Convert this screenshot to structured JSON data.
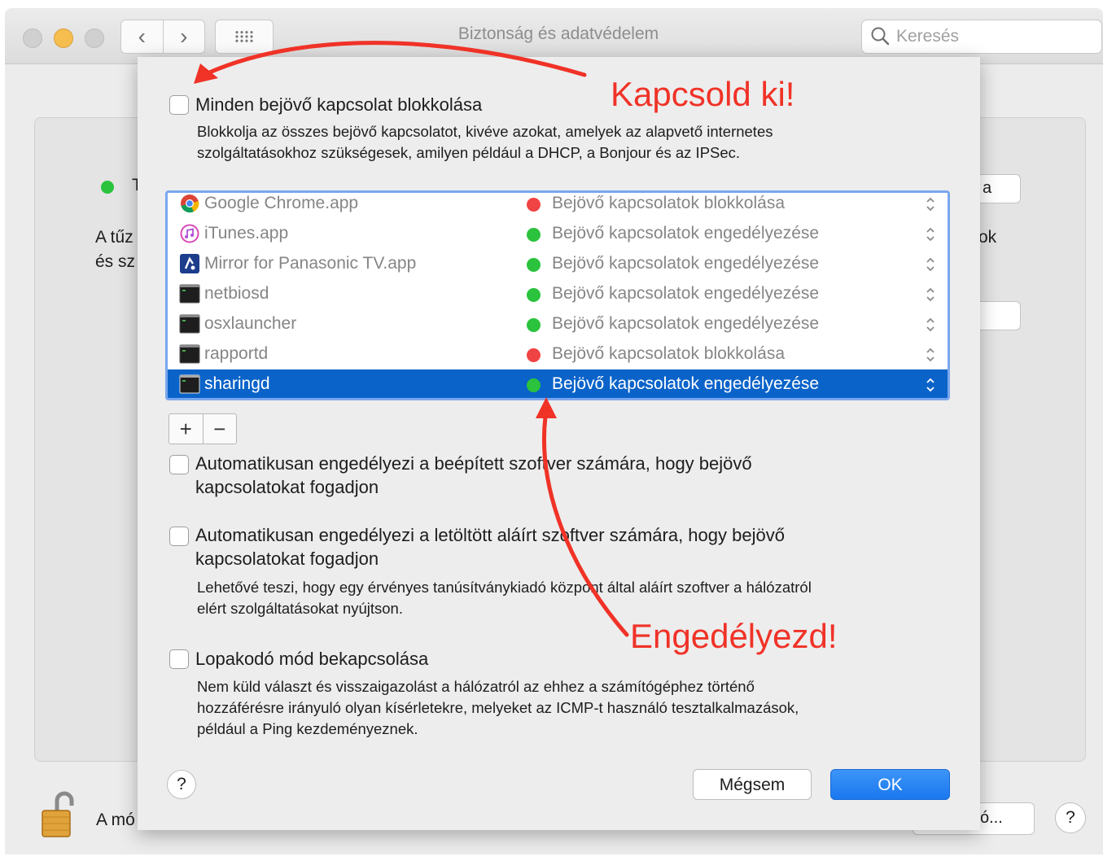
{
  "window": {
    "title": "Biztonság és adatvédelem",
    "search_placeholder": "Keresés"
  },
  "background": {
    "status_text": "T",
    "desc_line1": "A tűz",
    "desc_line2": "és sz",
    "right_fragment1": "ok",
    "button_fragment1": "a",
    "bottom_lock_text": "A mó",
    "bottom_button": "ó..."
  },
  "sheet": {
    "block_all": {
      "label": "Minden bejövő kapcsolat blokkolása",
      "checked": false,
      "desc_line1": "Blokkolja az összes bejövő kapcsolatot, kivéve azokat, amelyek az alapvető internetes",
      "desc_line2": "szolgáltatásokhoz szükségesek, amilyen például a DHCP, a Bonjour és az IPSec."
    },
    "apps": [
      {
        "name": "Google Chrome.app",
        "status": "Bejövő kapcsolatok blokkolása",
        "status_color": "#f04343",
        "icon": "chrome-icon"
      },
      {
        "name": "iTunes.app",
        "status": "Bejövő kapcsolatok engedélyezése",
        "status_color": "#2bc23d",
        "icon": "itunes-icon"
      },
      {
        "name": "Mirror for Panasonic TV.app",
        "status": "Bejövő kapcsolatok engedélyezése",
        "status_color": "#2bc23d",
        "icon": "mirror-app-icon"
      },
      {
        "name": "netbiosd",
        "status": "Bejövő kapcsolatok engedélyezése",
        "status_color": "#2bc23d",
        "icon": "terminal-icon"
      },
      {
        "name": "osxlauncher",
        "status": "Bejövő kapcsolatok engedélyezése",
        "status_color": "#2bc23d",
        "icon": "terminal-icon"
      },
      {
        "name": "rapportd",
        "status": "Bejövő kapcsolatok blokkolása",
        "status_color": "#f04343",
        "icon": "terminal-icon"
      },
      {
        "name": "sharingd",
        "status": "Bejövő kapcsolatok engedélyezése",
        "status_color": "#2bc23d",
        "icon": "terminal-icon",
        "selected": true
      }
    ],
    "add_label": "+",
    "remove_label": "−",
    "auto_builtin": {
      "label_line1": "Automatikusan engedélyezi a beépített szoftver számára, hogy bejövő",
      "label_line2": "kapcsolatokat fogadjon",
      "checked": false
    },
    "auto_signed": {
      "label_line1": "Automatikusan engedélyezi a letöltött aláírt szoftver számára, hogy bejövő",
      "label_line2": "kapcsolatokat fogadjon",
      "checked": false,
      "desc_line1": "Lehetővé teszi, hogy egy érvényes tanúsítványkiadó központ által aláírt szoftver a hálózatról",
      "desc_line2": "elért szolgáltatásokat nyújtson."
    },
    "stealth": {
      "label": "Lopakodó mód bekapcsolása",
      "checked": false,
      "desc_line1": "Nem küld választ és visszaigazolást a hálózatról az ehhez a számítógéphez történő",
      "desc_line2": "hozzáférésre irányuló olyan kísérletekre, melyeket az ICMP-t használó tesztalkalmazások,",
      "desc_line3": "például a Ping kezdeményeznek."
    },
    "help_label": "?",
    "cancel_label": "Mégsem",
    "ok_label": "OK"
  },
  "annotations": {
    "top": "Kapcsold ki!",
    "bottom": "Engedélyezd!",
    "color": "#f03227"
  },
  "help_label": "?"
}
